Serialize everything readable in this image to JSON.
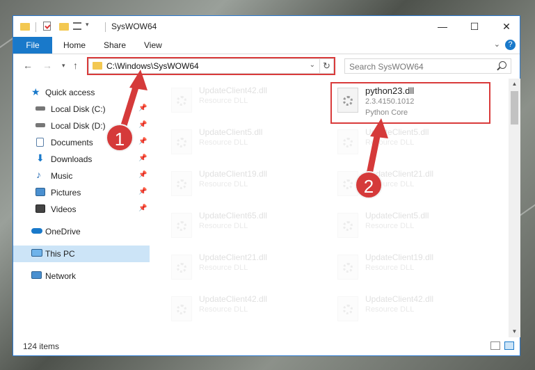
{
  "window": {
    "title": "SysWOW64",
    "controls": {
      "minimize": "—",
      "maximize": "☐",
      "close": "✕"
    }
  },
  "ribbon": {
    "tabs": [
      "File",
      "Home",
      "Share",
      "View"
    ],
    "help": "?"
  },
  "address": {
    "path": "C:\\Windows\\SysWOW64",
    "search_placeholder": "Search SysWOW64"
  },
  "nav": [
    {
      "label": "Quick access",
      "icon": "star-icon",
      "pinned": false
    },
    {
      "label": "Local Disk (C:)",
      "icon": "drive-icon",
      "pinned": true
    },
    {
      "label": "Local Disk (D:)",
      "icon": "drive-icon",
      "pinned": true
    },
    {
      "label": "Documents",
      "icon": "documents-icon",
      "pinned": true
    },
    {
      "label": "Downloads",
      "icon": "download-icon",
      "pinned": true
    },
    {
      "label": "Music",
      "icon": "music-icon",
      "pinned": true
    },
    {
      "label": "Pictures",
      "icon": "pictures-icon",
      "pinned": true
    },
    {
      "label": "Videos",
      "icon": "videos-icon",
      "pinned": true
    },
    {
      "label": "OneDrive",
      "icon": "cloud-icon",
      "pinned": false
    },
    {
      "label": "This PC",
      "icon": "computer-icon",
      "pinned": false,
      "selected": true
    },
    {
      "label": "Network",
      "icon": "network-icon",
      "pinned": false
    }
  ],
  "files": [
    {
      "name": "UpdateClient42.dll",
      "desc": "Resource DLL"
    },
    {
      "name": "python23.dll",
      "desc": "2.3.4150.1012",
      "ver": "Python Core",
      "highlighted": true
    },
    {
      "name": "UpdateClient5.dll",
      "desc": "Resource DLL"
    },
    {
      "name": "UpdateClient5.dll",
      "desc": "Resource DLL"
    },
    {
      "name": "UpdateClient19.dll",
      "desc": "Resource DLL"
    },
    {
      "name": "UpdateClient21.dll",
      "desc": "Resource DLL"
    },
    {
      "name": "UpdateClient65.dll",
      "desc": "Resource DLL"
    },
    {
      "name": "UpdateClient5.dll",
      "desc": "Resource DLL"
    },
    {
      "name": "UpdateClient21.dll",
      "desc": "Resource DLL"
    },
    {
      "name": "UpdateClient19.dll",
      "desc": "Resource DLL"
    },
    {
      "name": "UpdateClient42.dll",
      "desc": "Resource DLL"
    },
    {
      "name": "UpdateClient42.dll",
      "desc": "Resource DLL"
    }
  ],
  "status": {
    "count": "124 items"
  },
  "annotations": {
    "step1": "1",
    "step2": "2"
  },
  "colors": {
    "accent": "#1979ca",
    "highlight": "#d93a3a",
    "selected": "#cce4f7"
  }
}
